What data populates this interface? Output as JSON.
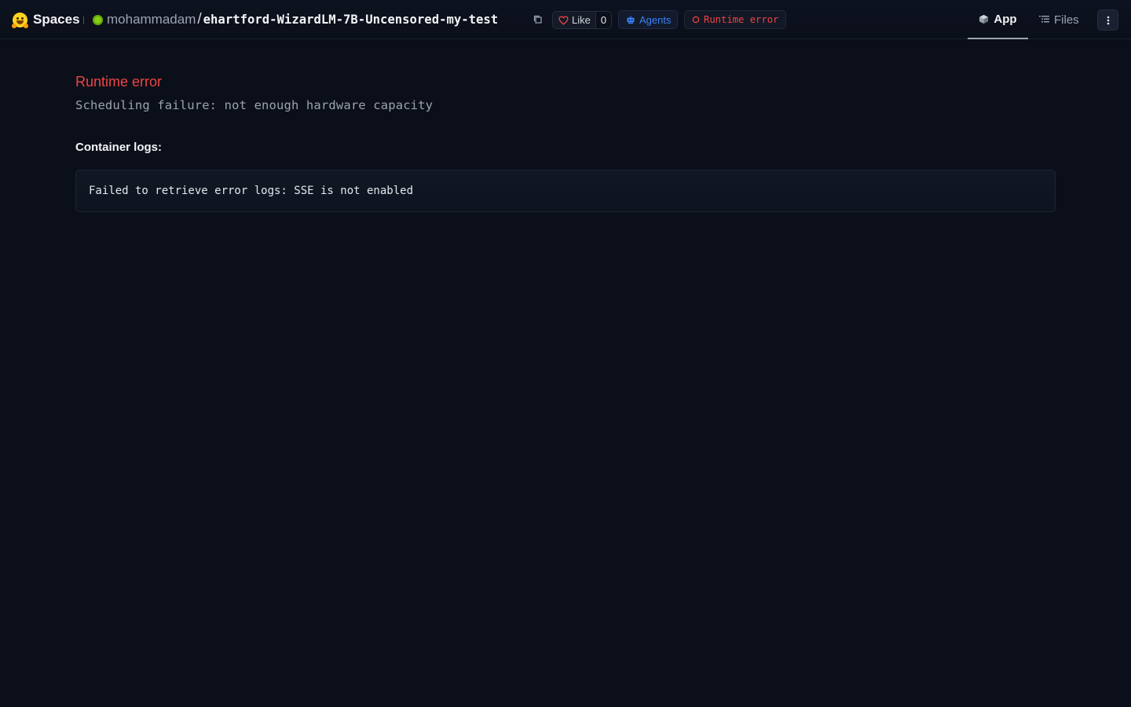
{
  "header": {
    "brand_label": "Spaces",
    "owner": "mohammadam",
    "separator": "/",
    "repo_name": "ehartford-WizardLM-7B-Uncensored-my-test",
    "like_label": "Like",
    "like_count": "0",
    "agents_label": "Agents",
    "status_badge": "Runtime error",
    "tabs": [
      {
        "label": "App",
        "icon": "cube-icon",
        "active": true
      },
      {
        "label": "Files",
        "icon": "files-icon",
        "active": false
      }
    ],
    "menu_icon": "more-vertical-icon"
  },
  "main": {
    "error_title": "Runtime error",
    "error_message": "Scheduling failure: not enough hardware capacity",
    "logs_label": "Container logs:",
    "logs_text": "Failed to retrieve error logs: SSE is not enabled"
  },
  "colors": {
    "background": "#0b0f19",
    "error": "#ef4444",
    "accent_blue": "#3b82f6",
    "status_green": "#84cc16"
  }
}
